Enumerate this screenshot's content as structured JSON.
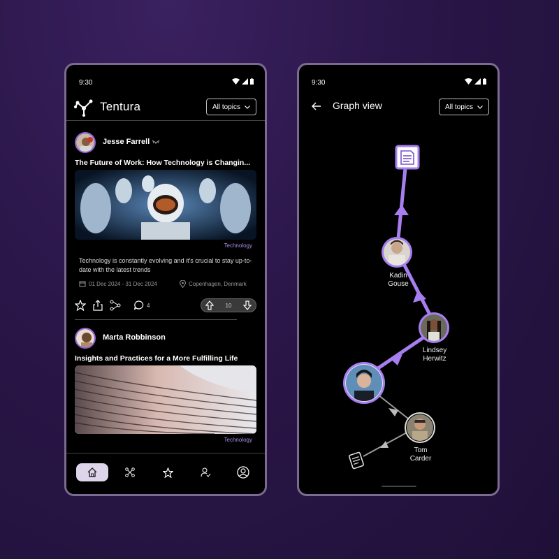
{
  "status": {
    "time": "9:30"
  },
  "feed": {
    "brand": "Tentura",
    "topics_label": "All topics",
    "posts": [
      {
        "author": "Jesse Farrell",
        "title": "The Future of Work: How Technology is Changin...",
        "tag": "Technology",
        "description": "Technology is constantly evolving and it's crucial to stay up-to-date with the latest trends",
        "dates": "01 Dec 2024 - 31 Dec 2024",
        "location": "Copenhagen, Denmark",
        "comments": "4",
        "votes": "10"
      },
      {
        "author": "Marta Robbinson",
        "title": "Insights and Practices for a More Fulfilling Life",
        "tag": "Technology"
      }
    ],
    "nav": [
      "home-icon",
      "graph-icon",
      "star-icon",
      "friends-icon",
      "profile-icon"
    ]
  },
  "graph": {
    "title": "Graph view",
    "topics_label": "All topics",
    "nodes": [
      {
        "id": "kadin",
        "line1": "Kadin",
        "line2": "Gouse"
      },
      {
        "id": "lindsey",
        "line1": "Lindsey",
        "line2": "Herwitz"
      },
      {
        "id": "tom",
        "line1": "Tom",
        "line2": "Carder"
      }
    ]
  },
  "colors": {
    "accent": "#a77ef0",
    "edge_inactive": "#9a9a9a",
    "bg": "#2a1648"
  }
}
